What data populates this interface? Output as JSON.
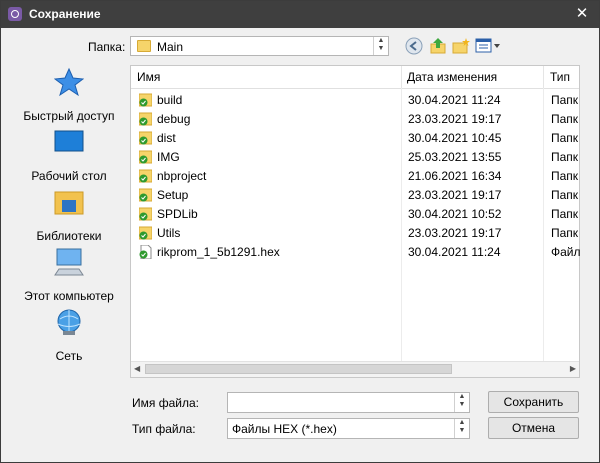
{
  "window": {
    "title": "Сохранение"
  },
  "folder": {
    "label": "Папка:",
    "current": "Main"
  },
  "places": [
    {
      "label": "Быстрый доступ",
      "icon": "star-icon"
    },
    {
      "label": "Рабочий стол",
      "icon": "desktop-icon"
    },
    {
      "label": "Библиотеки",
      "icon": "library-icon"
    },
    {
      "label": "Этот компьютер",
      "icon": "computer-icon"
    },
    {
      "label": "Сеть",
      "icon": "network-icon"
    }
  ],
  "columns": {
    "name": "Имя",
    "date": "Дата изменения",
    "type": "Тип"
  },
  "files": [
    {
      "name": "build",
      "date": "30.04.2021 11:24",
      "type": "Папк",
      "kind": "folder"
    },
    {
      "name": "debug",
      "date": "23.03.2021 19:17",
      "type": "Папк",
      "kind": "folder"
    },
    {
      "name": "dist",
      "date": "30.04.2021 10:45",
      "type": "Папк",
      "kind": "folder"
    },
    {
      "name": "IMG",
      "date": "25.03.2021 13:55",
      "type": "Папк",
      "kind": "folder"
    },
    {
      "name": "nbproject",
      "date": "21.06.2021 16:34",
      "type": "Папк",
      "kind": "folder"
    },
    {
      "name": "Setup",
      "date": "23.03.2021 19:17",
      "type": "Папк",
      "kind": "folder"
    },
    {
      "name": "SPDLib",
      "date": "30.04.2021 10:52",
      "type": "Папк",
      "kind": "folder"
    },
    {
      "name": "Utils",
      "date": "23.03.2021 19:17",
      "type": "Папк",
      "kind": "folder"
    },
    {
      "name": "rikprom_1_5b1291.hex",
      "date": "30.04.2021 11:24",
      "type": "Файл",
      "kind": "file"
    }
  ],
  "form": {
    "filename_label": "Имя файла:",
    "filename_value": "",
    "filetype_label": "Тип файла:",
    "filetype_value": "Файлы HEX (*.hex)",
    "save_label": "Сохранить",
    "cancel_label": "Отмена"
  },
  "colors": {
    "titlebar": "#3f3f3f",
    "folder": "#f6d46a",
    "check": "#2e9a2e",
    "accent": "#2b7bd6"
  }
}
